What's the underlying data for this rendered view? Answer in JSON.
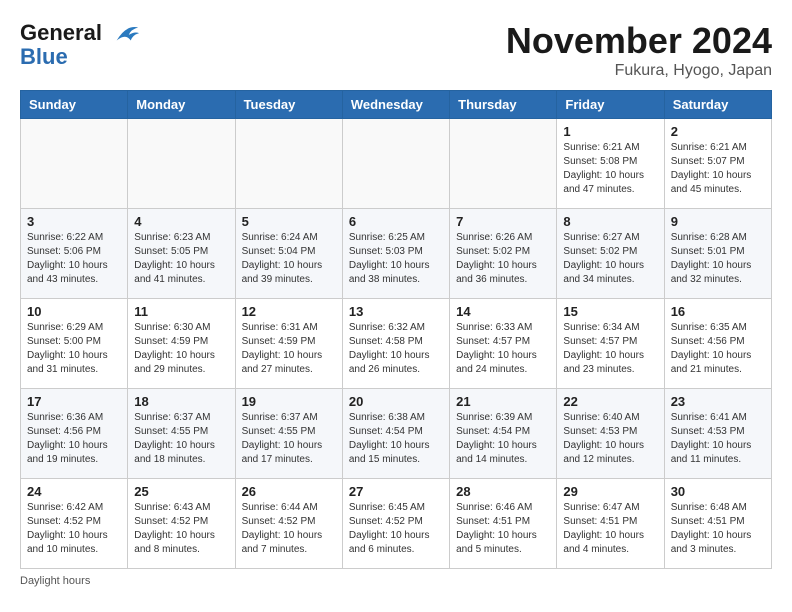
{
  "header": {
    "logo_line1": "General",
    "logo_line2": "Blue",
    "month": "November 2024",
    "location": "Fukura, Hyogo, Japan"
  },
  "days_of_week": [
    "Sunday",
    "Monday",
    "Tuesday",
    "Wednesday",
    "Thursday",
    "Friday",
    "Saturday"
  ],
  "weeks": [
    [
      {
        "day": "",
        "info": ""
      },
      {
        "day": "",
        "info": ""
      },
      {
        "day": "",
        "info": ""
      },
      {
        "day": "",
        "info": ""
      },
      {
        "day": "",
        "info": ""
      },
      {
        "day": "1",
        "info": "Sunrise: 6:21 AM\nSunset: 5:08 PM\nDaylight: 10 hours and 47 minutes."
      },
      {
        "day": "2",
        "info": "Sunrise: 6:21 AM\nSunset: 5:07 PM\nDaylight: 10 hours and 45 minutes."
      }
    ],
    [
      {
        "day": "3",
        "info": "Sunrise: 6:22 AM\nSunset: 5:06 PM\nDaylight: 10 hours and 43 minutes."
      },
      {
        "day": "4",
        "info": "Sunrise: 6:23 AM\nSunset: 5:05 PM\nDaylight: 10 hours and 41 minutes."
      },
      {
        "day": "5",
        "info": "Sunrise: 6:24 AM\nSunset: 5:04 PM\nDaylight: 10 hours and 39 minutes."
      },
      {
        "day": "6",
        "info": "Sunrise: 6:25 AM\nSunset: 5:03 PM\nDaylight: 10 hours and 38 minutes."
      },
      {
        "day": "7",
        "info": "Sunrise: 6:26 AM\nSunset: 5:02 PM\nDaylight: 10 hours and 36 minutes."
      },
      {
        "day": "8",
        "info": "Sunrise: 6:27 AM\nSunset: 5:02 PM\nDaylight: 10 hours and 34 minutes."
      },
      {
        "day": "9",
        "info": "Sunrise: 6:28 AM\nSunset: 5:01 PM\nDaylight: 10 hours and 32 minutes."
      }
    ],
    [
      {
        "day": "10",
        "info": "Sunrise: 6:29 AM\nSunset: 5:00 PM\nDaylight: 10 hours and 31 minutes."
      },
      {
        "day": "11",
        "info": "Sunrise: 6:30 AM\nSunset: 4:59 PM\nDaylight: 10 hours and 29 minutes."
      },
      {
        "day": "12",
        "info": "Sunrise: 6:31 AM\nSunset: 4:59 PM\nDaylight: 10 hours and 27 minutes."
      },
      {
        "day": "13",
        "info": "Sunrise: 6:32 AM\nSunset: 4:58 PM\nDaylight: 10 hours and 26 minutes."
      },
      {
        "day": "14",
        "info": "Sunrise: 6:33 AM\nSunset: 4:57 PM\nDaylight: 10 hours and 24 minutes."
      },
      {
        "day": "15",
        "info": "Sunrise: 6:34 AM\nSunset: 4:57 PM\nDaylight: 10 hours and 23 minutes."
      },
      {
        "day": "16",
        "info": "Sunrise: 6:35 AM\nSunset: 4:56 PM\nDaylight: 10 hours and 21 minutes."
      }
    ],
    [
      {
        "day": "17",
        "info": "Sunrise: 6:36 AM\nSunset: 4:56 PM\nDaylight: 10 hours and 19 minutes."
      },
      {
        "day": "18",
        "info": "Sunrise: 6:37 AM\nSunset: 4:55 PM\nDaylight: 10 hours and 18 minutes."
      },
      {
        "day": "19",
        "info": "Sunrise: 6:37 AM\nSunset: 4:55 PM\nDaylight: 10 hours and 17 minutes."
      },
      {
        "day": "20",
        "info": "Sunrise: 6:38 AM\nSunset: 4:54 PM\nDaylight: 10 hours and 15 minutes."
      },
      {
        "day": "21",
        "info": "Sunrise: 6:39 AM\nSunset: 4:54 PM\nDaylight: 10 hours and 14 minutes."
      },
      {
        "day": "22",
        "info": "Sunrise: 6:40 AM\nSunset: 4:53 PM\nDaylight: 10 hours and 12 minutes."
      },
      {
        "day": "23",
        "info": "Sunrise: 6:41 AM\nSunset: 4:53 PM\nDaylight: 10 hours and 11 minutes."
      }
    ],
    [
      {
        "day": "24",
        "info": "Sunrise: 6:42 AM\nSunset: 4:52 PM\nDaylight: 10 hours and 10 minutes."
      },
      {
        "day": "25",
        "info": "Sunrise: 6:43 AM\nSunset: 4:52 PM\nDaylight: 10 hours and 8 minutes."
      },
      {
        "day": "26",
        "info": "Sunrise: 6:44 AM\nSunset: 4:52 PM\nDaylight: 10 hours and 7 minutes."
      },
      {
        "day": "27",
        "info": "Sunrise: 6:45 AM\nSunset: 4:52 PM\nDaylight: 10 hours and 6 minutes."
      },
      {
        "day": "28",
        "info": "Sunrise: 6:46 AM\nSunset: 4:51 PM\nDaylight: 10 hours and 5 minutes."
      },
      {
        "day": "29",
        "info": "Sunrise: 6:47 AM\nSunset: 4:51 PM\nDaylight: 10 hours and 4 minutes."
      },
      {
        "day": "30",
        "info": "Sunrise: 6:48 AM\nSunset: 4:51 PM\nDaylight: 10 hours and 3 minutes."
      }
    ]
  ],
  "footer_note": "Daylight hours"
}
